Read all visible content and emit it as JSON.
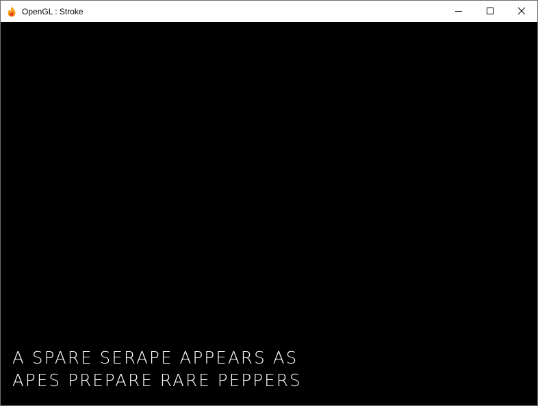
{
  "window": {
    "title": "OpenGL : Stroke",
    "app_icon": "flame-icon",
    "controls": {
      "minimize_icon": "minimize-icon",
      "maximize_icon": "maximize-icon",
      "close_icon": "close-icon"
    }
  },
  "canvas": {
    "background": "#000000",
    "text_color": "#ffffff",
    "lines": [
      "A SPARE SERAPE APPEARS AS",
      "APES PREPARE RARE PEPPERS"
    ]
  }
}
